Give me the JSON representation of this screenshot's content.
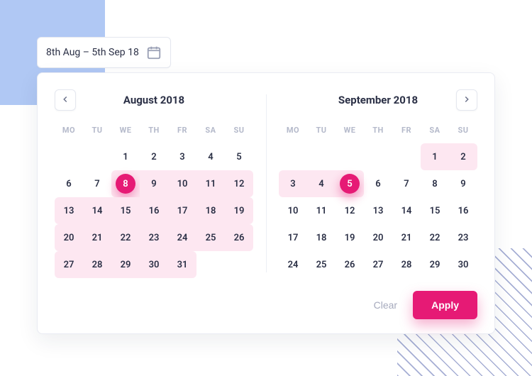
{
  "colors": {
    "accent": "#e61a75",
    "range": "#fde7f1"
  },
  "input": {
    "value": "8th Aug – 5th Sep 18"
  },
  "weekdays": [
    "MO",
    "TU",
    "WE",
    "TH",
    "FR",
    "SA",
    "SU"
  ],
  "months": [
    {
      "id": "aug",
      "title": "August 2018",
      "nav": "prev",
      "leading_blanks": 2,
      "days": [
        {
          "n": 1
        },
        {
          "n": 2
        },
        {
          "n": 3
        },
        {
          "n": 4
        },
        {
          "n": 5
        },
        {
          "n": 6
        },
        {
          "n": 7
        },
        {
          "n": 8,
          "endpoint": true,
          "in": true,
          "rs": true
        },
        {
          "n": 9,
          "in": true
        },
        {
          "n": 10,
          "in": true
        },
        {
          "n": 11,
          "in": true
        },
        {
          "n": 12,
          "in": true,
          "re": true
        },
        {
          "n": 13,
          "in": true,
          "rs": true
        },
        {
          "n": 14,
          "in": true
        },
        {
          "n": 15,
          "in": true
        },
        {
          "n": 16,
          "in": true
        },
        {
          "n": 17,
          "in": true
        },
        {
          "n": 18,
          "in": true
        },
        {
          "n": 19,
          "in": true,
          "re": true
        },
        {
          "n": 20,
          "in": true,
          "rs": true
        },
        {
          "n": 21,
          "in": true
        },
        {
          "n": 22,
          "in": true
        },
        {
          "n": 23,
          "in": true
        },
        {
          "n": 24,
          "in": true
        },
        {
          "n": 25,
          "in": true
        },
        {
          "n": 26,
          "in": true,
          "re": true
        },
        {
          "n": 27,
          "in": true,
          "rs": true
        },
        {
          "n": 28,
          "in": true
        },
        {
          "n": 29,
          "in": true
        },
        {
          "n": 30,
          "in": true
        },
        {
          "n": 31,
          "in": true,
          "re": true
        }
      ]
    },
    {
      "id": "sep",
      "title": "September 2018",
      "nav": "next",
      "leading_blanks": 5,
      "days": [
        {
          "n": 1,
          "in": true,
          "rs": true
        },
        {
          "n": 2,
          "in": true,
          "re": true
        },
        {
          "n": 3,
          "in": true,
          "rs": true
        },
        {
          "n": 4,
          "in": true
        },
        {
          "n": 5,
          "endpoint": true,
          "in": true,
          "re": true
        },
        {
          "n": 6
        },
        {
          "n": 7
        },
        {
          "n": 8
        },
        {
          "n": 9
        },
        {
          "n": 10
        },
        {
          "n": 11
        },
        {
          "n": 12
        },
        {
          "n": 13
        },
        {
          "n": 14
        },
        {
          "n": 15
        },
        {
          "n": 16
        },
        {
          "n": 17
        },
        {
          "n": 18
        },
        {
          "n": 19
        },
        {
          "n": 20
        },
        {
          "n": 21
        },
        {
          "n": 22
        },
        {
          "n": 23
        },
        {
          "n": 24
        },
        {
          "n": 25
        },
        {
          "n": 26
        },
        {
          "n": 27
        },
        {
          "n": 28
        },
        {
          "n": 29
        },
        {
          "n": 30
        }
      ]
    }
  ],
  "actions": {
    "clear": "Clear",
    "apply": "Apply"
  }
}
